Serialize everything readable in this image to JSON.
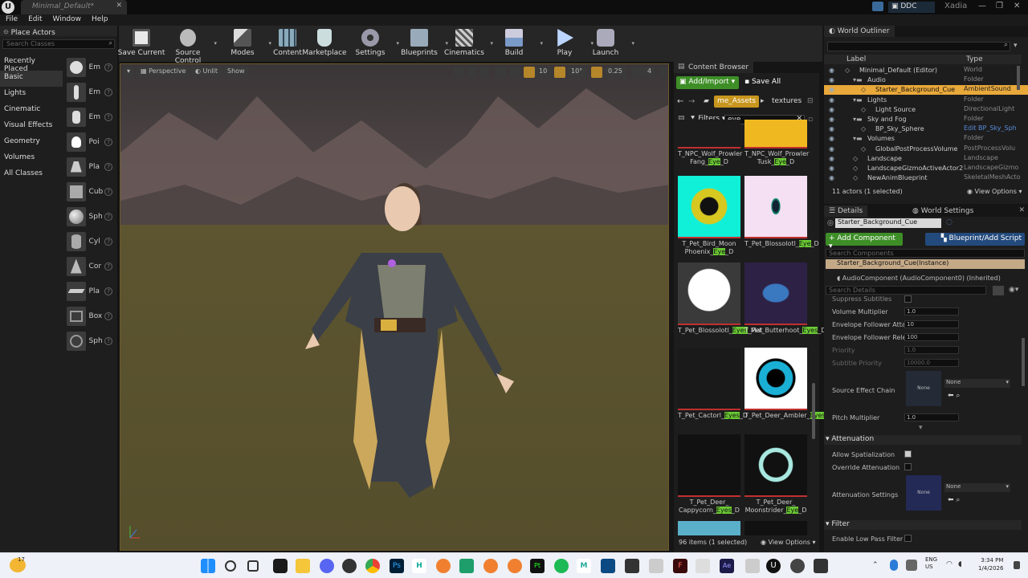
{
  "window": {
    "tab_title": "Minimal_Default*",
    "close": "✕",
    "ddc_label": "DDC",
    "project_name": "Xadia"
  },
  "menu": [
    "File",
    "Edit",
    "Window",
    "Help"
  ],
  "place_actors": {
    "title": "Place Actors",
    "search_placeholder": "Search Classes",
    "categories": [
      "Recently Placed",
      "Basic",
      "Lights",
      "Cinematic",
      "Visual Effects",
      "Geometry",
      "Volumes",
      "All Classes"
    ],
    "selected_category": "Basic",
    "items": [
      "Em",
      "Em",
      "Em",
      "Poi",
      "Pla",
      "Cub",
      "Sph",
      "Cyl",
      "Cor",
      "Pla",
      "Box",
      "Sph"
    ]
  },
  "toolbar": [
    {
      "label": "Save Current",
      "icon": "save-icon"
    },
    {
      "label": "Source Control",
      "icon": "source-control-icon"
    },
    {
      "label": "Modes",
      "icon": "modes-icon"
    },
    {
      "label": "Content",
      "icon": "content-icon"
    },
    {
      "label": "Marketplace",
      "icon": "marketplace-icon"
    },
    {
      "label": "Settings",
      "icon": "settings-icon"
    },
    {
      "label": "Blueprints",
      "icon": "blueprints-icon"
    },
    {
      "label": "Cinematics",
      "icon": "cinematics-icon"
    },
    {
      "label": "Build",
      "icon": "build-icon"
    },
    {
      "label": "Play",
      "icon": "play-icon"
    },
    {
      "label": "Launch",
      "icon": "launch-icon"
    }
  ],
  "viewport": {
    "perspective": "Perspective",
    "unlit": "Unlit",
    "show": "Show",
    "grid_snap": "10",
    "rot_snap": "10°",
    "scale_snap": "0.25",
    "camera_speed": "4"
  },
  "content_browser": {
    "tab": "Content Browser",
    "add_import": "Add/Import",
    "save_all": "Save All",
    "breadcrumb": [
      "me_Assets",
      "textures"
    ],
    "filters": "Filters",
    "search_value": "eye",
    "status": "96 items (1 selected)",
    "view_options": "View Options",
    "assets": [
      {
        "name_pre": "T_NPC_Wolf_Prowler Fang_",
        "match": "Eye",
        "name_post": "_D",
        "color": "#1c1c1c"
      },
      {
        "name_pre": "T_NPC_Wolf_Prowler Tusk_",
        "match": "Eye",
        "name_post": "_D",
        "color": "#f0b820"
      },
      {
        "name_pre": "T_Pet_Bird_Moon Phoenix_",
        "match": "Eye",
        "name_post": "_D",
        "color": "#10f0d8"
      },
      {
        "name_pre": "T_Pet_Blossolotl_",
        "match": "Eye",
        "name_post": "_D",
        "color": "#f5dff2"
      },
      {
        "name_pre": "T_Pet_Blossolotl_",
        "match": "Eyes",
        "name_post": "_Mat",
        "color": "#3a3a3a"
      },
      {
        "name_pre": "T_Pet_Butterhoot_",
        "match": "Eyes",
        "name_post": "_D",
        "color": "#2d2145"
      },
      {
        "name_pre": "T_Pet_Cactorl_",
        "match": "Eyes",
        "name_post": "_D",
        "color": "#1a1a1a"
      },
      {
        "name_pre": "T_Pet_Deer_Ambler_",
        "match": "Eyes",
        "name_post": "_D",
        "color": "#ffffff"
      },
      {
        "name_pre": "T_Pet_Deer_ Cappycorn_",
        "match": "Eyes",
        "name_post": "_D",
        "color": "#111111"
      },
      {
        "name_pre": "T_Pet_Deer_ Moonstrider_",
        "match": "Eye",
        "name_post": "_D",
        "color": "#111111"
      }
    ]
  },
  "world_outliner": {
    "title": "World Outliner",
    "col_label": "Label",
    "col_type": "Type",
    "rows": [
      {
        "label": "Minimal_Default (Editor)",
        "type": "World",
        "indent": 0
      },
      {
        "label": "Audio",
        "type": "Folder",
        "indent": 1
      },
      {
        "label": "Starter_Background_Cue",
        "type": "AmbientSound",
        "indent": 2,
        "selected": true
      },
      {
        "label": "Lights",
        "type": "Folder",
        "indent": 1
      },
      {
        "label": "Light Source",
        "type": "DirectionalLight",
        "indent": 2
      },
      {
        "label": "Sky and Fog",
        "type": "Folder",
        "indent": 1
      },
      {
        "label": "BP_Sky_Sphere",
        "type": "Edit BP_Sky_Sph",
        "indent": 2
      },
      {
        "label": "Volumes",
        "type": "Folder",
        "indent": 1
      },
      {
        "label": "GlobalPostProcessVolume",
        "type": "PostProcessVolu",
        "indent": 2
      },
      {
        "label": "Landscape",
        "type": "Landscape",
        "indent": 1
      },
      {
        "label": "LandscapeGizmoActiveActor2",
        "type": "LandscapeGizmo",
        "indent": 1
      },
      {
        "label": "NewAnimBlueprint",
        "type": "SkeletalMeshActo",
        "indent": 1
      }
    ],
    "status": "11 actors (1 selected)",
    "view_options": "View Options"
  },
  "details": {
    "tab": "Details",
    "tab2": "World Settings",
    "actor_name": "Starter_Background_Cue",
    "add_component": "+ Add Component",
    "blueprint_script": "Blueprint/Add Script",
    "search_components": "Search Components",
    "instance": "Starter_Background_Cue(Instance)",
    "component": "AudioComponent (AudioComponent0) (Inherited)",
    "search_details": "Search Details",
    "props": [
      {
        "label": "Suppress Subtitles",
        "kind": "check"
      },
      {
        "label": "Volume Multiplier",
        "value": "1.0"
      },
      {
        "label": "Envelope Follower Attack",
        "value": "10"
      },
      {
        "label": "Envelope Follower Releas",
        "value": "100"
      },
      {
        "label": "Priority",
        "value": "1.0"
      },
      {
        "label": "Subtitle Priority",
        "value": "10000.0"
      }
    ],
    "source_effect_chain": "Source Effect Chain",
    "none": "None",
    "pitch_multiplier": "Pitch Multiplier",
    "pitch_value": "1.0",
    "attenuation": "Attenuation",
    "allow_spatialization": "Allow Spatialization",
    "override_attenuation": "Override Attenuation",
    "attenuation_settings": "Attenuation Settings",
    "filter": "Filter",
    "enable_low_pass": "Enable Low Pass Filter"
  },
  "taskbar": {
    "time": "3:34 PM",
    "date": "1/4/2026",
    "lang1": "ENG",
    "lang2": "US",
    "weather_badge": "17"
  }
}
